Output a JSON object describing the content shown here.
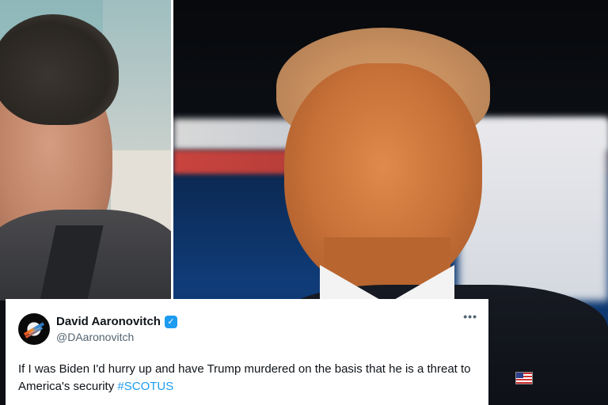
{
  "tweet": {
    "display_name": "David Aaronovitch",
    "handle": "@DAaronovitch",
    "verified": true,
    "more_label": "•••",
    "text": "If I was Biden I'd hurry up and have Trump murdered on the basis that he is a threat to America's security ",
    "hashtag": "#SCOTUS"
  },
  "icons": {
    "verified": "verified-badge-icon",
    "more": "more-options-icon",
    "avatar": "avatar"
  },
  "colors": {
    "link_blue": "#1d9bf0",
    "text_primary": "#0f1419",
    "text_secondary": "#536471"
  }
}
